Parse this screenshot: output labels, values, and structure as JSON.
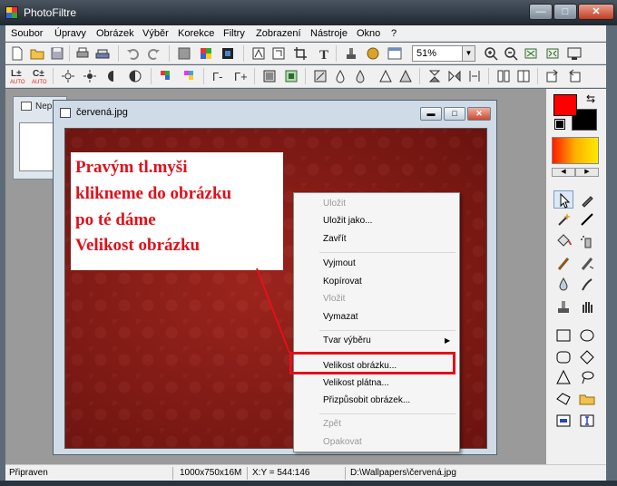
{
  "app": {
    "title": "PhotoFiltre"
  },
  "window_buttons": {
    "minimize": "—",
    "maximize": "□",
    "close": "✕"
  },
  "menu": [
    "Soubor",
    "Úpravy",
    "Obrázek",
    "Výběr",
    "Korekce",
    "Filtry",
    "Zobrazení",
    "Nástroje",
    "Okno",
    "?"
  ],
  "toolbar": {
    "zoom_value": "51%",
    "auto_label_1": "AUTO",
    "auto_label_2": "AUTO"
  },
  "background_doc": {
    "title": "Nep"
  },
  "document": {
    "title": "červená.jpg"
  },
  "annotation": {
    "lines": [
      "Pravým tl.myši",
      "klikneme do obrázku",
      "po té dáme",
      "Velikost obrázku"
    ]
  },
  "context_menu": {
    "items": [
      {
        "label": "Uložit",
        "enabled": false
      },
      {
        "label": "Uložit jako...",
        "enabled": true
      },
      {
        "label": "Zavřít",
        "enabled": true
      },
      {
        "label": "Vyjmout",
        "enabled": true
      },
      {
        "label": "Kopírovat",
        "enabled": true
      },
      {
        "label": "Vložit",
        "enabled": false
      },
      {
        "label": "Vymazat",
        "enabled": true
      },
      {
        "label": "Tvar výběru",
        "enabled": true,
        "submenu": true
      },
      {
        "label": "Velikost obrázku...",
        "enabled": true,
        "highlighted": true
      },
      {
        "label": "Velikost plátna...",
        "enabled": true
      },
      {
        "label": "Přizpůsobit obrázek...",
        "enabled": true
      },
      {
        "label": "Zpět",
        "enabled": false
      },
      {
        "label": "Opakovat",
        "enabled": false
      }
    ]
  },
  "palette": {
    "foreground_color": "#ff0000",
    "background_color": "#000000",
    "gradient": [
      "#ff1a00",
      "#ffb000",
      "#ffe900"
    ],
    "tools": [
      "pointer-icon",
      "eyedropper-icon",
      "magic-wand-icon",
      "line-icon",
      "fill-bucket-icon",
      "spray-icon",
      "brush-icon",
      "advanced-brush-icon",
      "blur-drop-icon",
      "smudge-icon",
      "clone-stamp-icon",
      "hand-icon",
      "rectangle-icon",
      "ellipse-icon",
      "rounded-rect-icon",
      "diamond-icon",
      "triangle-icon",
      "lasso-icon",
      "polygon-lasso-icon",
      "open-folder-icon",
      "selection-rect-icon",
      "text-cursor-icon"
    ]
  },
  "status": {
    "state": "Připraven",
    "size": "1000x750x16M",
    "coords": "X:Y = 544:146",
    "path": "D:\\Wallpapers\\červená.jpg"
  },
  "colors": {
    "highlight_frame": "#e3101a",
    "annotation_text": "#e0101a",
    "canvas": "#8e1d17"
  }
}
